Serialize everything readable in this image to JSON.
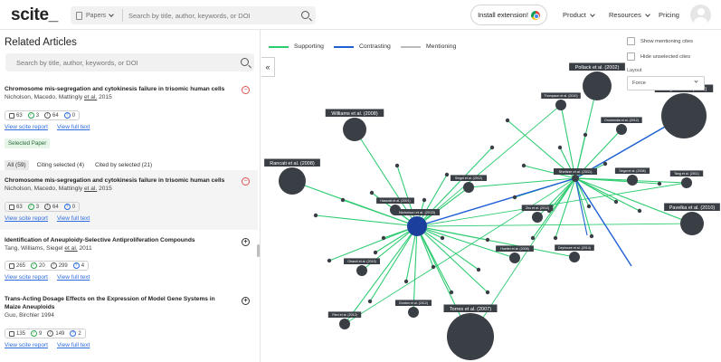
{
  "header": {
    "logo": "scite_",
    "search_scope": "Papers",
    "search_placeholder": "Search by title, author, keywords, or DOI",
    "install_label": "Install extension!",
    "nav": {
      "product": "Product",
      "resources": "Resources",
      "pricing": "Pricing"
    }
  },
  "left": {
    "title": "Related Articles",
    "search_placeholder": "Search by title, author, keywords, or DOI",
    "selected_chip": "Selected Paper",
    "tabs": [
      "All (59)",
      "Citing selected (4)",
      "Cited by selected (21)"
    ],
    "articles": [
      {
        "title": "Chromosome mis-segregation and cytokinesis failure in trisomic human cells",
        "authors_prefix": "Nicholson, Macedo, Mattingly ",
        "etal": "et al.",
        "year": " 2015",
        "cites": "63",
        "supporting": "3",
        "mentioning": "64",
        "contrasting": "0",
        "action": "−"
      },
      {
        "title": "Chromosome mis-segregation and cytokinesis failure in trisomic human cells",
        "authors_prefix": "Nicholson, Macedo, Mattingly ",
        "etal": "et al.",
        "year": " 2015",
        "cites": "63",
        "supporting": "3",
        "mentioning": "64",
        "contrasting": "0",
        "action": "−"
      },
      {
        "title": "Identification of Aneuploidy-Selective Antiproliferation Compounds",
        "authors_prefix": "Tang, Williams, Siegel ",
        "etal": "et al.",
        "year": " 2011",
        "cites": "265",
        "supporting": "20",
        "mentioning": "299",
        "contrasting": "4",
        "action": "+"
      },
      {
        "title": "Trans-Acting Dosage Effects on the Expression of Model Gene Systems in Maize Aneuploids",
        "authors_prefix": "Guo, Birchler 1994",
        "etal": "",
        "year": "",
        "cites": "135",
        "supporting": "9",
        "mentioning": "149",
        "contrasting": "2",
        "action": "+"
      }
    ],
    "link_report": "View scite report",
    "link_full": "View full text"
  },
  "graph": {
    "legend": {
      "supporting": "Supporting",
      "contrasting": "Contrasting",
      "mentioning": "Mentioning"
    },
    "options": {
      "show_mentioning": "Show mentioning cites",
      "hide_unselected": "Hide unselected cites"
    },
    "layout_label": "Layout",
    "layout_value": "Force",
    "colors": {
      "supporting": "#2ecc71",
      "contrasting": "#1f5fd6",
      "mentioning": "#bbbbbb",
      "node": "#3a3f45",
      "selected_node": "#1a3f9c"
    },
    "hubs": [
      {
        "id": "A",
        "label": "Nicholson et al. (2015)",
        "selected": true
      },
      {
        "id": "B",
        "label": "Sheltzer et al. (2011)",
        "selected": false
      }
    ],
    "nodes": [
      {
        "label": "Torres et al. (2007)",
        "big": true
      },
      {
        "label": "Williams et al. (2008)",
        "big": true
      },
      {
        "label": "Pollack et al. (2002)",
        "big": true
      },
      {
        "label": "Pavelka et al. (2010)",
        "big": true
      },
      {
        "label": "Rancati et al. (2008)",
        "big": true
      },
      {
        "label": "Stingele et al. (2012)",
        "big": true
      },
      {
        "label": "Thompson et al. (2010)",
        "big": false
      },
      {
        "label": "Oromendia et al. (2012)",
        "big": false
      },
      {
        "label": "Segal et al. (2008)",
        "big": false
      },
      {
        "label": "Tang et al. (2011)",
        "big": false
      },
      {
        "label": "Zhu et al. (2012)",
        "big": false
      },
      {
        "label": "Dephoure et al. (2014)",
        "big": false
      },
      {
        "label": "Siegel et al. (2012)",
        "big": false
      },
      {
        "label": "Huettel et al. (2008)",
        "big": false
      },
      {
        "label": "Gordon et al. (2012)",
        "big": false
      },
      {
        "label": "Ried et al. (2012)",
        "big": false
      },
      {
        "label": "Ohashi et al. (2015)",
        "big": false
      },
      {
        "label": "Hassold et al. (2001)",
        "big": false
      }
    ]
  }
}
